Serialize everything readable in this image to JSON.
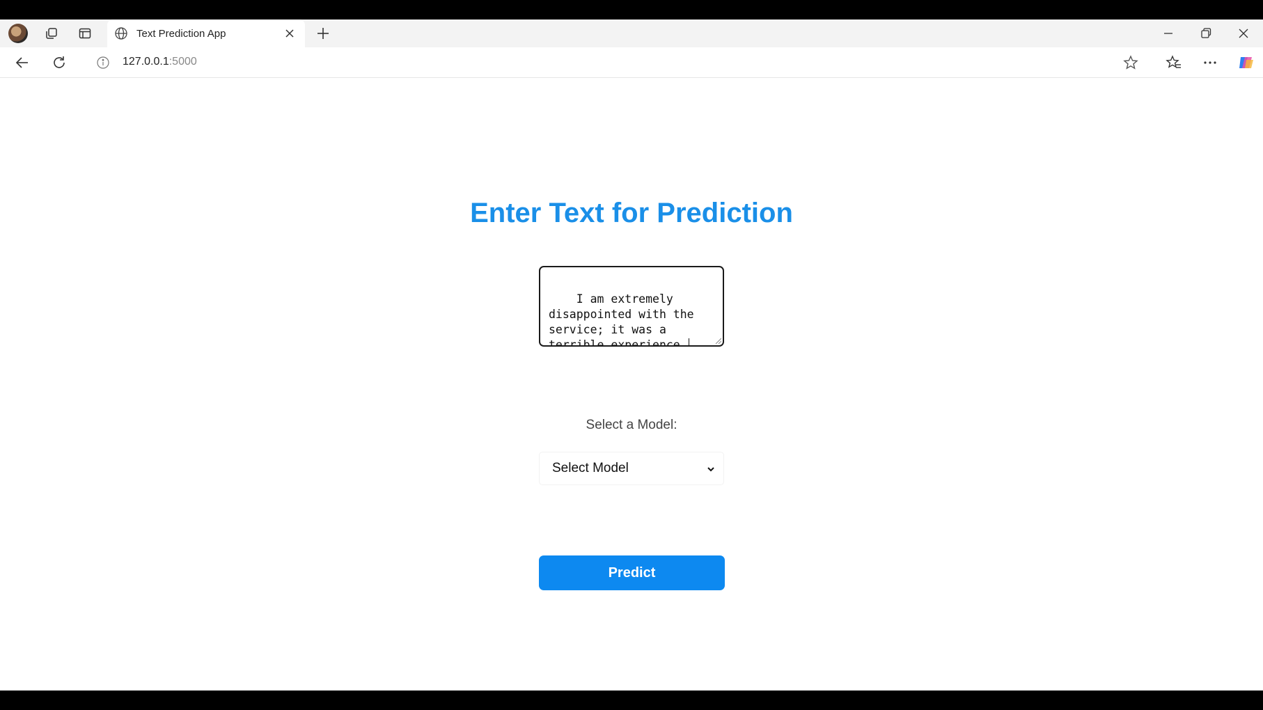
{
  "browser": {
    "tab_title": "Text Prediction App",
    "url_host": "127.0.0.1",
    "url_port": ":5000",
    "icons": [
      "profile-avatar",
      "workspaces-icon",
      "tab-actions-icon",
      "globe-icon",
      "close-icon",
      "new-tab-icon",
      "minimize-icon",
      "restore-icon",
      "window-close-icon",
      "back-icon",
      "refresh-icon",
      "info-icon",
      "favorite-star-icon",
      "favorites-icon",
      "more-icon",
      "copilot-icon"
    ]
  },
  "page": {
    "heading": "Enter Text for Prediction",
    "input_text": "I am extremely disappointed with the service; it was a terrible experience.",
    "model_label": "Select a Model:",
    "model_select_value": "Select Model",
    "predict_label": "Predict"
  },
  "colors": {
    "heading": "#1a8fe8",
    "button": "#0d89f0"
  }
}
